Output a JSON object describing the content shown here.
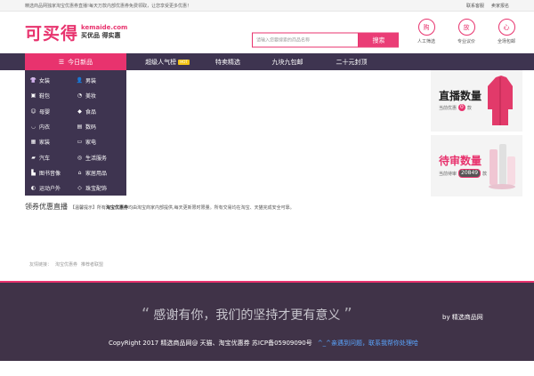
{
  "topbar": {
    "notice": "精选商品网独家淘宝优惠券直播!每天万款内部优惠券免费领取，让您享受更多优惠！",
    "links": [
      "联系客服",
      "卖家报名"
    ]
  },
  "header": {
    "logo_main": "可买得",
    "logo_domain": "kemaide.com",
    "logo_slogan": "买优品 得实惠",
    "search_placeholder": "请输入您要搜索的商品名称",
    "search_button": "搜索",
    "badges": [
      {
        "char": "购",
        "label": "人工筛选"
      },
      {
        "char": "放",
        "label": "专业议价"
      },
      {
        "char": "心",
        "label": "全场包邮"
      }
    ]
  },
  "nav": {
    "first": "今日新品",
    "items": [
      {
        "label": "超级人气榜",
        "hot": "HOT"
      },
      {
        "label": "特卖精选"
      },
      {
        "label": "九块九包邮"
      },
      {
        "label": "二十元封顶"
      }
    ]
  },
  "categories": [
    {
      "label": "女装",
      "icon": "shirt-icon",
      "glyph": "👚"
    },
    {
      "label": "男装",
      "icon": "man-icon",
      "glyph": "👤"
    },
    {
      "label": "鞋包",
      "icon": "shoe-icon",
      "glyph": "▣"
    },
    {
      "label": "美妆",
      "icon": "cosmetics-icon",
      "glyph": "◔"
    },
    {
      "label": "母婴",
      "icon": "baby-icon",
      "glyph": "☺"
    },
    {
      "label": "食品",
      "icon": "food-icon",
      "glyph": "◆"
    },
    {
      "label": "内衣",
      "icon": "lingerie-icon",
      "glyph": "◡"
    },
    {
      "label": "数码",
      "icon": "digital-icon",
      "glyph": "▤"
    },
    {
      "label": "家装",
      "icon": "furniture-icon",
      "glyph": "▦"
    },
    {
      "label": "家电",
      "icon": "appliance-icon",
      "glyph": "▭"
    },
    {
      "label": "汽车",
      "icon": "car-icon",
      "glyph": "▰"
    },
    {
      "label": "生活服务",
      "icon": "service-icon",
      "glyph": "◎"
    },
    {
      "label": "图书音像",
      "icon": "book-icon",
      "glyph": "▙"
    },
    {
      "label": "家居用品",
      "icon": "home-icon",
      "glyph": "⌂"
    },
    {
      "label": "运动户外",
      "icon": "sport-icon",
      "glyph": "◐"
    },
    {
      "label": "珠宝配饰",
      "icon": "jewel-icon",
      "glyph": "◇"
    }
  ],
  "cards": [
    {
      "title": "直播数量",
      "sub_prefix": "当前优惠",
      "count": "0",
      "sub_suffix": "款"
    },
    {
      "title": "待审数量",
      "sub_prefix": "当前待审",
      "count": "20849",
      "sub_suffix": "款"
    }
  ],
  "coupon": {
    "title": "领券优惠直播",
    "tip_prefix": "【温馨提示】所有",
    "tip_bold": "淘宝优惠券",
    "tip_suffix": "均由淘宝商家内部提供,每天更新限时限量。所有交易均在淘宝、天猫完成安全可靠。"
  },
  "friends": {
    "label": "友情链接：",
    "links": [
      "淘宝优惠券",
      "推荐者联盟"
    ]
  },
  "footer": {
    "open_quote": "“",
    "close_quote": "”",
    "quote": "感谢有你，我们的坚持才更有意义",
    "by": "by  精选商品网",
    "copyright": "CopyRight 2017  精选商品网@ 天猫、淘宝优惠券   苏ICP备05909090号",
    "help": "^_^亲遇到问题，联系我帮你处理哈"
  },
  "colors": {
    "accent": "#e8336e",
    "nav_bg": "#3e3450",
    "footer_bg": "#403348"
  }
}
